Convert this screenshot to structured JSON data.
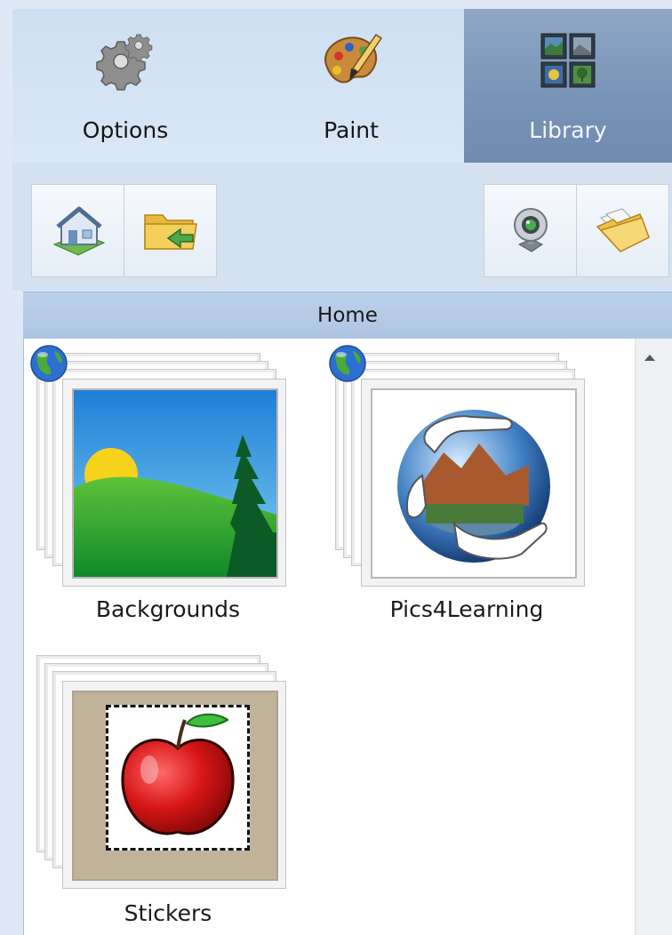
{
  "tabs": [
    {
      "label": "Options",
      "icon": "gear-icon",
      "active": false
    },
    {
      "label": "Paint",
      "icon": "palette-icon",
      "active": false
    },
    {
      "label": "Library",
      "icon": "library-grid-icon",
      "active": true
    }
  ],
  "toolbar": {
    "left_buttons": [
      {
        "icon": "home-icon",
        "title": "Home"
      },
      {
        "icon": "folder-back-icon",
        "title": "Back"
      }
    ],
    "right_buttons": [
      {
        "icon": "webcam-icon",
        "title": "Webcam"
      },
      {
        "icon": "open-folder-icon",
        "title": "Open"
      }
    ]
  },
  "breadcrumb": {
    "label": "Home"
  },
  "items": [
    {
      "label": "Backgrounds",
      "online": true,
      "thumbnail": "landscape"
    },
    {
      "label": "Pics4Learning",
      "online": true,
      "thumbnail": "globe-hands"
    },
    {
      "label": "Stickers",
      "online": false,
      "thumbnail": "apple-sticker"
    }
  ],
  "colors": {
    "active_tab": "#7893b7",
    "breadcrumb_bg": "#b6cbe6",
    "sticker_bg": "#c1b29a"
  }
}
